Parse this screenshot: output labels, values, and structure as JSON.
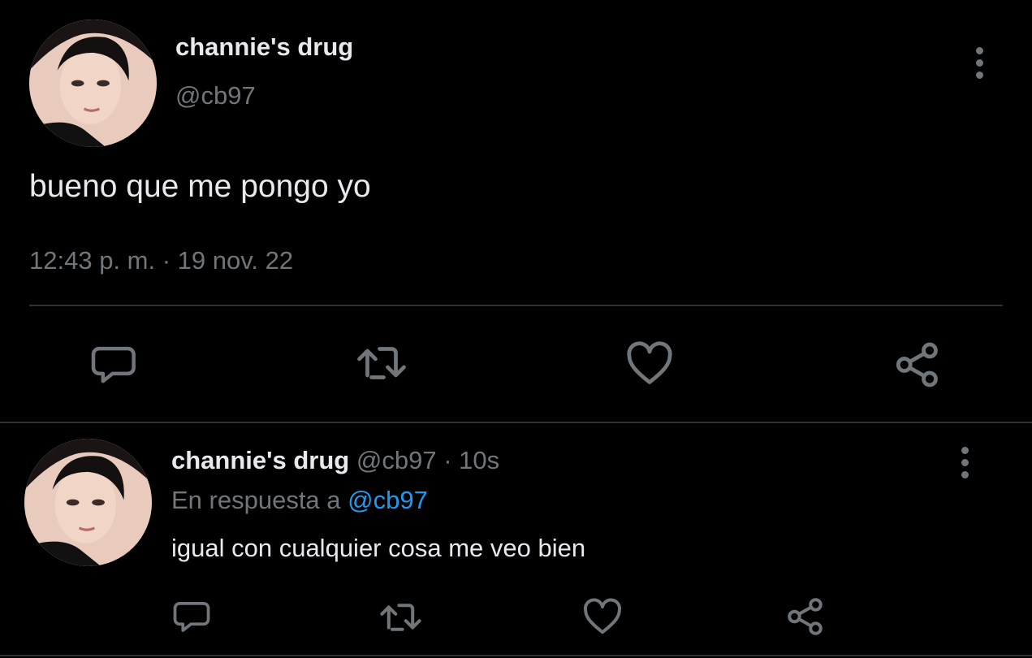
{
  "main_tweet": {
    "display_name": "channie's drug",
    "handle": "@cb97",
    "text": "bueno que me pongo yo",
    "timestamp": "12:43 p. m. · 19 nov. 22",
    "actions": [
      "reply-icon",
      "retweet-icon",
      "like-icon",
      "share-icon"
    ]
  },
  "reply": {
    "display_name": "channie's drug",
    "handle": "@cb97",
    "time_ago": "· 10s",
    "in_reply_prefix": "En respuesta a",
    "in_reply_handle": "@cb97",
    "text": "igual con cualquier cosa me veo bien",
    "actions": [
      "reply-icon",
      "retweet-icon",
      "like-icon",
      "share-icon"
    ]
  },
  "colors": {
    "background": "#000000",
    "text": "#e7e9ea",
    "muted": "#71767b",
    "link": "#1d9bf0",
    "divider": "#2f3336"
  }
}
